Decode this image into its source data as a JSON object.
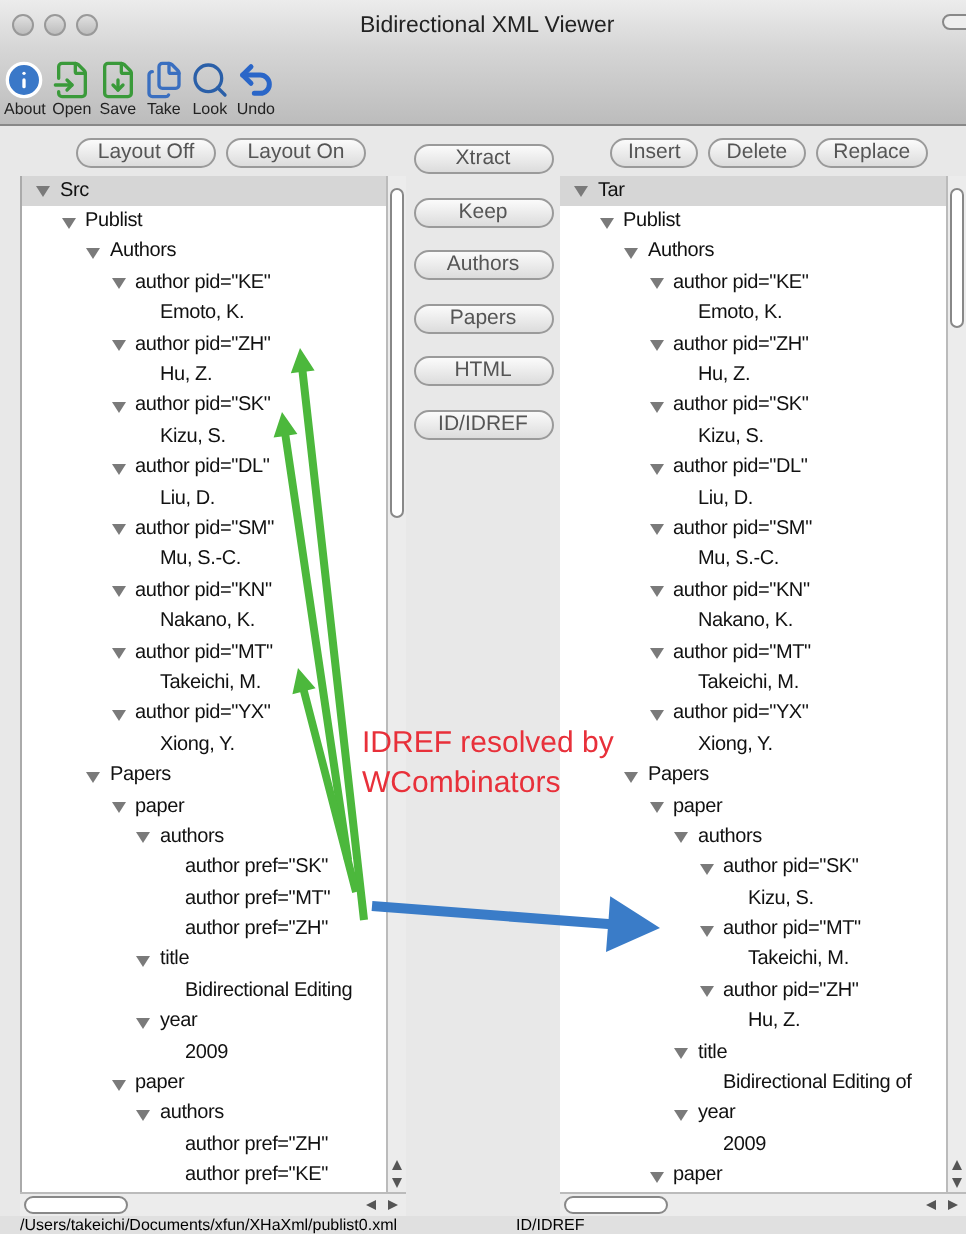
{
  "window": {
    "title": "Bidirectional XML Viewer"
  },
  "toolbar": [
    {
      "label": "About",
      "kind": "info"
    },
    {
      "label": "Open",
      "kind": "open"
    },
    {
      "label": "Save",
      "kind": "save"
    },
    {
      "label": "Take",
      "kind": "take"
    },
    {
      "label": "Look",
      "kind": "look"
    },
    {
      "label": "Undo",
      "kind": "undo"
    }
  ],
  "left_buttons": [
    "Layout Off",
    "Layout On"
  ],
  "middle_buttons": [
    "Xtract",
    "Keep",
    "Authors",
    "Papers",
    "HTML",
    "ID/IDREF"
  ],
  "right_buttons": [
    "Insert",
    "Delete",
    "Replace"
  ],
  "src_tree": {
    "label": "Src",
    "expanded": true,
    "children": [
      {
        "label": "Publist",
        "expanded": true,
        "children": [
          {
            "label": "Authors",
            "expanded": true,
            "children": [
              {
                "label": "author pid=\"KE\"",
                "expanded": true,
                "children": [
                  {
                    "label": "Emoto, K."
                  }
                ]
              },
              {
                "label": "author pid=\"ZH\"",
                "expanded": true,
                "children": [
                  {
                    "label": "Hu, Z."
                  }
                ]
              },
              {
                "label": "author pid=\"SK\"",
                "expanded": true,
                "children": [
                  {
                    "label": "Kizu, S."
                  }
                ]
              },
              {
                "label": "author pid=\"DL\"",
                "expanded": true,
                "children": [
                  {
                    "label": "Liu, D."
                  }
                ]
              },
              {
                "label": "author pid=\"SM\"",
                "expanded": true,
                "children": [
                  {
                    "label": "Mu, S.-C."
                  }
                ]
              },
              {
                "label": "author pid=\"KN\"",
                "expanded": true,
                "children": [
                  {
                    "label": "Nakano, K."
                  }
                ]
              },
              {
                "label": "author pid=\"MT\"",
                "expanded": true,
                "children": [
                  {
                    "label": "Takeichi, M."
                  }
                ]
              },
              {
                "label": "author pid=\"YX\"",
                "expanded": true,
                "children": [
                  {
                    "label": "Xiong, Y."
                  }
                ]
              }
            ]
          },
          {
            "label": "Papers",
            "expanded": true,
            "children": [
              {
                "label": "paper",
                "expanded": true,
                "children": [
                  {
                    "label": "authors",
                    "expanded": true,
                    "children": [
                      {
                        "label": "author pref=\"SK\""
                      },
                      {
                        "label": "author pref=\"MT\""
                      },
                      {
                        "label": "author pref=\"ZH\""
                      }
                    ]
                  },
                  {
                    "label": "title",
                    "expanded": true,
                    "children": [
                      {
                        "label": "Bidirectional Editing"
                      }
                    ]
                  },
                  {
                    "label": "year",
                    "expanded": true,
                    "children": [
                      {
                        "label": "2009"
                      }
                    ]
                  }
                ]
              },
              {
                "label": "paper",
                "expanded": true,
                "children": [
                  {
                    "label": "authors",
                    "expanded": true,
                    "children": [
                      {
                        "label": "author pref=\"ZH\""
                      },
                      {
                        "label": "author pref=\"KE\""
                      }
                    ]
                  }
                ]
              }
            ]
          }
        ]
      }
    ]
  },
  "tar_tree": {
    "label": "Tar",
    "expanded": true,
    "children": [
      {
        "label": "Publist",
        "expanded": true,
        "children": [
          {
            "label": "Authors",
            "expanded": true,
            "children": [
              {
                "label": "author pid=\"KE\"",
                "expanded": true,
                "children": [
                  {
                    "label": "Emoto, K."
                  }
                ]
              },
              {
                "label": "author pid=\"ZH\"",
                "expanded": true,
                "children": [
                  {
                    "label": "Hu, Z."
                  }
                ]
              },
              {
                "label": "author pid=\"SK\"",
                "expanded": true,
                "children": [
                  {
                    "label": "Kizu, S."
                  }
                ]
              },
              {
                "label": "author pid=\"DL\"",
                "expanded": true,
                "children": [
                  {
                    "label": "Liu, D."
                  }
                ]
              },
              {
                "label": "author pid=\"SM\"",
                "expanded": true,
                "children": [
                  {
                    "label": "Mu, S.-C."
                  }
                ]
              },
              {
                "label": "author pid=\"KN\"",
                "expanded": true,
                "children": [
                  {
                    "label": "Nakano, K."
                  }
                ]
              },
              {
                "label": "author pid=\"MT\"",
                "expanded": true,
                "children": [
                  {
                    "label": "Takeichi, M."
                  }
                ]
              },
              {
                "label": "author pid=\"YX\"",
                "expanded": true,
                "children": [
                  {
                    "label": "Xiong, Y."
                  }
                ]
              }
            ]
          },
          {
            "label": "Papers",
            "expanded": true,
            "children": [
              {
                "label": "paper",
                "expanded": true,
                "children": [
                  {
                    "label": "authors",
                    "expanded": true,
                    "children": [
                      {
                        "label": "author pid=\"SK\"",
                        "expanded": true,
                        "children": [
                          {
                            "label": "Kizu, S."
                          }
                        ]
                      },
                      {
                        "label": "author pid=\"MT\"",
                        "expanded": true,
                        "children": [
                          {
                            "label": "Takeichi, M."
                          }
                        ]
                      },
                      {
                        "label": "author pid=\"ZH\"",
                        "expanded": true,
                        "children": [
                          {
                            "label": "Hu, Z."
                          }
                        ]
                      }
                    ]
                  },
                  {
                    "label": "title",
                    "expanded": true,
                    "children": [
                      {
                        "label": "Bidirectional Editing of"
                      }
                    ]
                  },
                  {
                    "label": "year",
                    "expanded": true,
                    "children": [
                      {
                        "label": "2009"
                      }
                    ]
                  }
                ]
              },
              {
                "label": "paper",
                "expanded": true
              }
            ]
          }
        ]
      }
    ]
  },
  "status_bar": {
    "path": "/Users/takeichi/Documents/xfun/XHaXml/publist0.xml",
    "mode": "ID/IDREF"
  },
  "annotation": {
    "lines": [
      "IDREF resolved by",
      "WCombinators"
    ]
  }
}
